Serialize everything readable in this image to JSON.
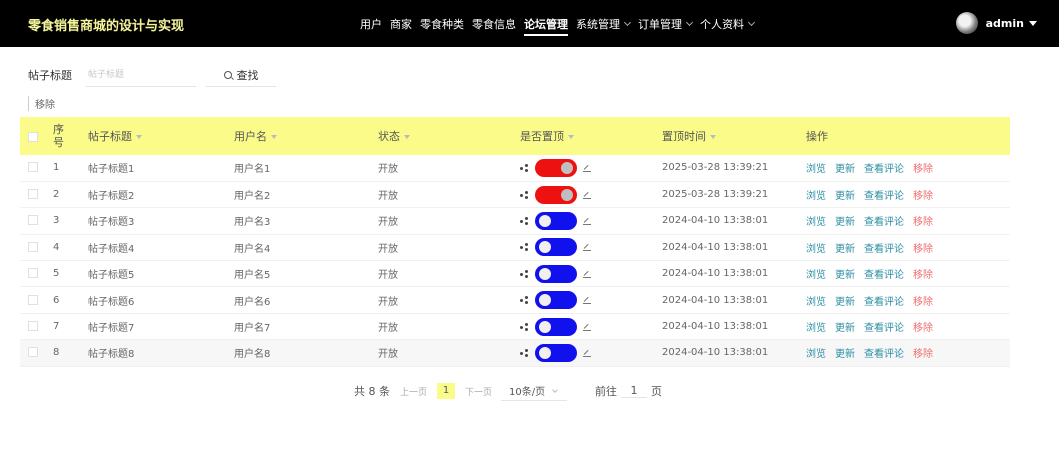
{
  "brand": "零食销售商城的设计与实现",
  "nav": [
    {
      "label": "用户",
      "dropdown": false,
      "active": false
    },
    {
      "label": "商家",
      "dropdown": false,
      "active": false
    },
    {
      "label": "零食种类",
      "dropdown": false,
      "active": false
    },
    {
      "label": "零食信息",
      "dropdown": false,
      "active": false
    },
    {
      "label": "论坛管理",
      "dropdown": false,
      "active": true
    },
    {
      "label": "系统管理",
      "dropdown": true,
      "active": false
    },
    {
      "label": "订单管理",
      "dropdown": true,
      "active": false
    },
    {
      "label": "个人资料",
      "dropdown": true,
      "active": false
    }
  ],
  "user": {
    "name": "admin"
  },
  "search": {
    "label": "帖子标题",
    "placeholder": "帖子标题",
    "value": "",
    "button": "查找"
  },
  "actions": {
    "remove_label": "移除"
  },
  "table": {
    "headers": {
      "index": "序号",
      "title": "帖子标题",
      "username": "用户名",
      "status": "状态",
      "is_top": "是否置顶",
      "top_time": "置顶时间",
      "ops": "操作"
    },
    "op_labels": {
      "view": "浏览",
      "update": "更新",
      "comments": "查看评论",
      "remove": "移除"
    },
    "rows": [
      {
        "index": "1",
        "title": "帖子标题1",
        "username": "用户名1",
        "status": "开放",
        "is_top": true,
        "top_time": "2025-03-28 13:39:21"
      },
      {
        "index": "2",
        "title": "帖子标题2",
        "username": "用户名2",
        "status": "开放",
        "is_top": true,
        "top_time": "2025-03-28 13:39:21"
      },
      {
        "index": "3",
        "title": "帖子标题3",
        "username": "用户名3",
        "status": "开放",
        "is_top": false,
        "top_time": "2024-04-10 13:38:01"
      },
      {
        "index": "4",
        "title": "帖子标题4",
        "username": "用户名4",
        "status": "开放",
        "is_top": false,
        "top_time": "2024-04-10 13:38:01"
      },
      {
        "index": "5",
        "title": "帖子标题5",
        "username": "用户名5",
        "status": "开放",
        "is_top": false,
        "top_time": "2024-04-10 13:38:01"
      },
      {
        "index": "6",
        "title": "帖子标题6",
        "username": "用户名6",
        "status": "开放",
        "is_top": false,
        "top_time": "2024-04-10 13:38:01"
      },
      {
        "index": "7",
        "title": "帖子标题7",
        "username": "用户名7",
        "status": "开放",
        "is_top": false,
        "top_time": "2024-04-10 13:38:01"
      },
      {
        "index": "8",
        "title": "帖子标题8",
        "username": "用户名8",
        "status": "开放",
        "is_top": false,
        "top_time": "2024-04-10 13:38:01"
      }
    ]
  },
  "pagination": {
    "total": "共 8 条",
    "prev": "上一页",
    "current": "1",
    "next": "下一页",
    "page_size": "10条/页",
    "goto_prefix": "前往",
    "goto_value": "1",
    "goto_suffix": "页"
  },
  "colors": {
    "accent": "#fbfb8a",
    "nav_bg": "#000000",
    "toggle_on": "#ee1111",
    "toggle_off": "#1111ee",
    "link": "#2a8ea3",
    "danger": "#f06d6d"
  }
}
